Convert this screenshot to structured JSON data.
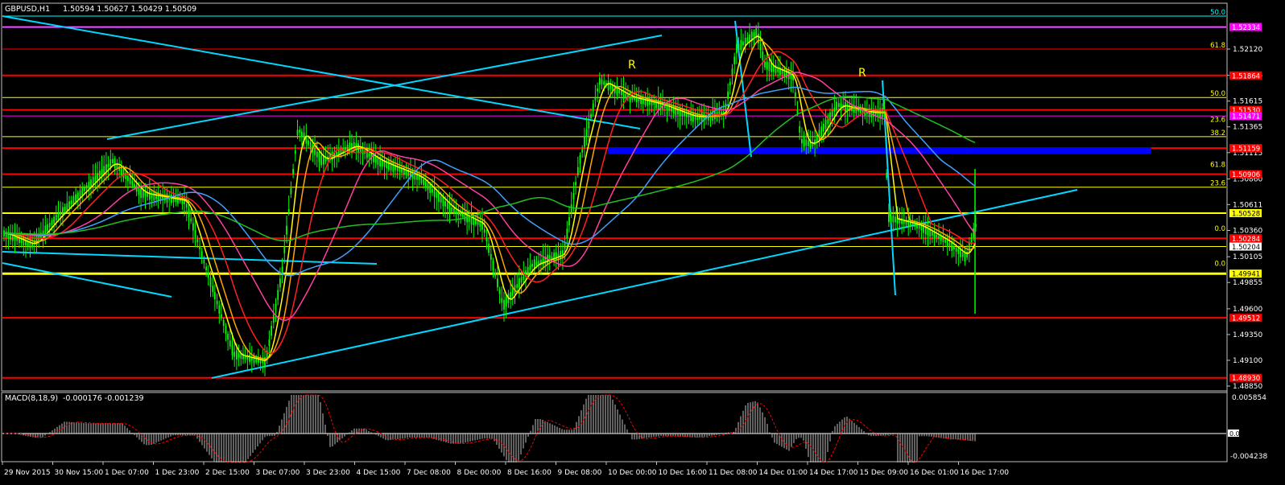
{
  "main": {
    "symbol_label": "GBPUSD,H1",
    "ohlc": "1.50594 1.50627 1.50429 1.50509",
    "price_scale": [
      "1.52120",
      "1.51865",
      "1.51615",
      "1.51365",
      "1.51115",
      "1.50860",
      "1.50611",
      "1.50360",
      "1.50105",
      "1.49855",
      "1.49600",
      "1.49350",
      "1.49100",
      "1.48850"
    ],
    "price_tags": [
      {
        "text": "1.52334",
        "color": "#ff00ff",
        "price": 1.52334
      },
      {
        "text": "1.51864",
        "color": "#ff0000",
        "price": 1.51864
      },
      {
        "text": "1.51530",
        "color": "#ff0000",
        "price": 1.5153
      },
      {
        "text": "1.51471",
        "color": "#ff00ff",
        "price": 1.51471
      },
      {
        "text": "1.51159",
        "color": "#ff0000",
        "price": 1.51159
      },
      {
        "text": "1.50906",
        "color": "#ff0000",
        "price": 1.50906
      },
      {
        "text": "1.50528",
        "color": "#ffff00",
        "price": 1.50528
      },
      {
        "text": "1.50284",
        "color": "#ff0000",
        "price": 1.50284
      },
      {
        "text": "1.50204",
        "color": "#ffffff",
        "price": 1.50204
      },
      {
        "text": "1.49941",
        "color": "#ffff00",
        "price": 1.49941
      },
      {
        "text": "1.49512",
        "color": "#ff0000",
        "price": 1.49512
      },
      {
        "text": "1.48930",
        "color": "#ff0000",
        "price": 1.4893
      }
    ],
    "fib_labels": [
      {
        "text": "50.0",
        "price": 1.5244,
        "color": "#00ffff"
      },
      {
        "text": "61.8",
        "price": 1.5212,
        "color": "#ffff00"
      },
      {
        "text": "50.0",
        "price": 1.5165,
        "color": "#ffff00"
      },
      {
        "text": "23.6",
        "price": 1.514,
        "color": "#ffff00"
      },
      {
        "text": "38.2",
        "price": 1.5127,
        "color": "#ffff00"
      },
      {
        "text": "61.8",
        "price": 1.5096,
        "color": "#ffff00"
      },
      {
        "text": "23.6",
        "price": 1.5078,
        "color": "#ffff00"
      },
      {
        "text": "0.0",
        "price": 1.5034,
        "color": "#ffff00"
      },
      {
        "text": "0.0",
        "price": 1.5,
        "color": "#ffff00"
      }
    ],
    "annotations": [
      "R",
      "R"
    ]
  },
  "macd": {
    "label": "MACD(8,18,9)",
    "values": "-0.000176 -0.001239",
    "scale": [
      "0.005854",
      "0.00",
      "-0.004238"
    ]
  },
  "time_axis": [
    "29 Nov 2015",
    "30 Nov 15:00",
    "1 Dec 07:00",
    "1 Dec 23:00",
    "2 Dec 15:00",
    "3 Dec 07:00",
    "3 Dec 23:00",
    "4 Dec 15:00",
    "7 Dec 08:00",
    "8 Dec 00:00",
    "8 Dec 16:00",
    "9 Dec 08:00",
    "10 Dec 00:00",
    "10 Dec 16:00",
    "11 Dec 08:00",
    "14 Dec 01:00",
    "14 Dec 17:00",
    "15 Dec 09:00",
    "16 Dec 01:00",
    "16 Dec 17:00"
  ],
  "colors": {
    "background": "#000000",
    "candles": "#00ff00",
    "grid_border": "#c0c0c0",
    "ma_yellow": "#ffff00",
    "ma_orange": "#ffa500",
    "ma_red": "#ff2020",
    "ma_magenta": "#ff3fa0",
    "ma_blue": "#3fa0ff",
    "ma_green": "#20c020",
    "trendline": "#00d8ff",
    "zone_blue": "#0000ff"
  },
  "chart_data": {
    "type": "line",
    "title": "GBPUSD,H1",
    "ylim": [
      1.4885,
      1.525
    ],
    "key_points": [
      {
        "x": "29 Nov 2015",
        "y": 1.503
      },
      {
        "x": "1 Dec 07:00",
        "y": 1.509
      },
      {
        "x": "2 Dec 15:00",
        "y": 1.49
      },
      {
        "x": "3 Dec 23:00",
        "y": 1.515
      },
      {
        "x": "4 Dec 15:00",
        "y": 1.511
      },
      {
        "x": "8 Dec 00:00",
        "y": 1.496
      },
      {
        "x": "9 Dec 08:00",
        "y": 1.517
      },
      {
        "x": "10 Dec 16:00",
        "y": 1.514
      },
      {
        "x": "11 Dec 08:00",
        "y": 1.524
      },
      {
        "x": "14 Dec 01:00",
        "y": 1.511
      },
      {
        "x": "14 Dec 17:00",
        "y": 1.516
      },
      {
        "x": "15 Dec 09:00",
        "y": 1.505
      },
      {
        "x": "16 Dec 01:00",
        "y": 1.5
      },
      {
        "x": "16 Dec 17:00",
        "y": 1.5051
      }
    ]
  }
}
